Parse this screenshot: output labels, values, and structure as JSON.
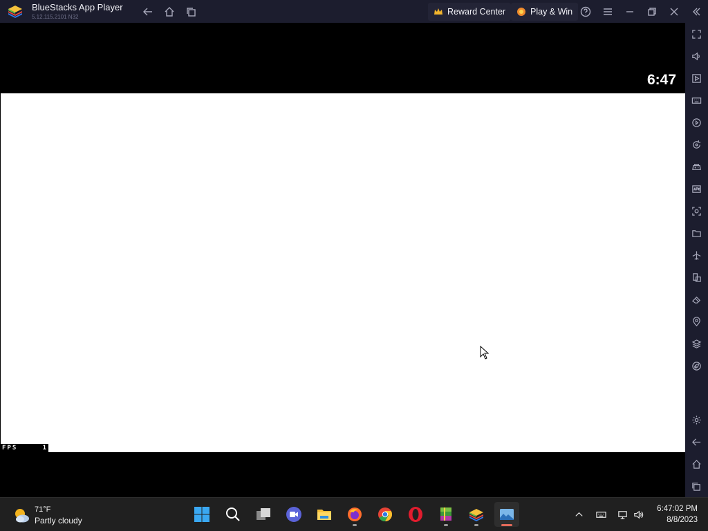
{
  "window": {
    "title": "BlueStacks App Player",
    "version": "5.12.115.2101 N32",
    "reward_center": "Reward Center",
    "play_win": "Play & Win"
  },
  "game": {
    "clock": "6:47",
    "fps_label": "FPS",
    "fps_value": "1"
  },
  "sidebar": {
    "icons": [
      "fullscreen-icon",
      "volume-icon",
      "media-icon",
      "keyboard-icon",
      "macro-icon",
      "rotate-icon",
      "gamepad-icon",
      "apk-icon",
      "screenshot-icon",
      "folder-icon",
      "airplane-icon",
      "multi-instance-icon",
      "eraser-icon",
      "location-icon",
      "layers-icon",
      "eco-icon",
      "settings-icon",
      "back-icon",
      "home-icon",
      "recents-icon"
    ]
  },
  "taskbar": {
    "weather_temp": "71°F",
    "weather_desc": "Partly cloudy",
    "time": "6:47:02 PM",
    "date": "8/8/2023",
    "apps": [
      "start",
      "search",
      "task-view",
      "zoom",
      "file-explorer",
      "firefox",
      "chrome",
      "opera",
      "winrar",
      "bluestacks",
      "photos"
    ]
  },
  "colors": {
    "titlebar": "#1c1d2e",
    "taskbar": "#202020",
    "accent": "#e26a5a"
  }
}
